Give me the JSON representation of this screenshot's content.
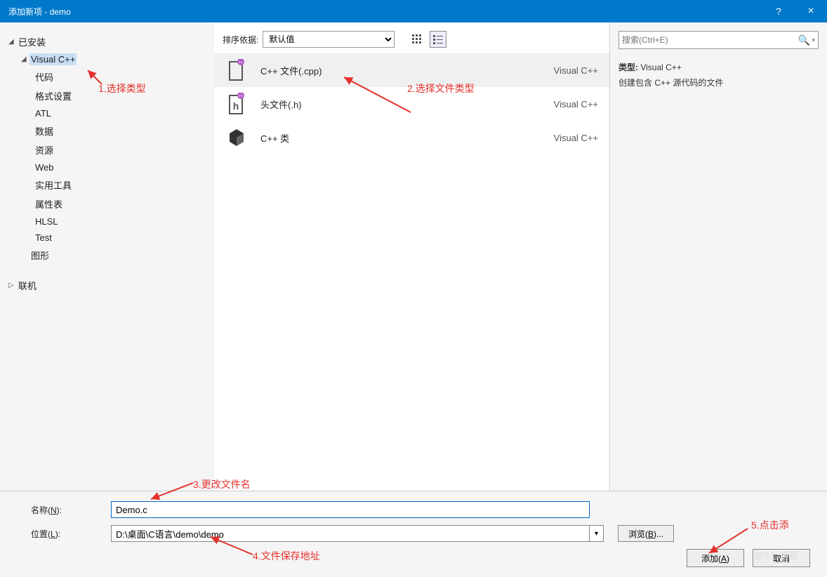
{
  "titlebar": {
    "title": "添加新项 - demo",
    "help": "?",
    "close": "×"
  },
  "sidebar": {
    "installed": "已安装",
    "visual_cpp": "Visual C++",
    "children": [
      "代码",
      "格式设置",
      "ATL",
      "数据",
      "资源",
      "Web",
      "实用工具",
      "属性表",
      "HLSL",
      "Test"
    ],
    "graphics": "图形",
    "online": "联机"
  },
  "sort": {
    "label": "排序依据:",
    "value": "默认值"
  },
  "templates": [
    {
      "name": "C++ 文件(.cpp)",
      "lang": "Visual C++"
    },
    {
      "name": "头文件(.h)",
      "lang": "Visual C++"
    },
    {
      "name": "C++ 类",
      "lang": "Visual C++"
    }
  ],
  "search": {
    "placeholder": "搜索(Ctrl+E)"
  },
  "info": {
    "type_label": "类型:",
    "type_value": "Visual C++",
    "desc": "创建包含 C++ 源代码的文件"
  },
  "form": {
    "name_label_pre": "名称(",
    "name_label_u": "N",
    "name_label_post": "):",
    "name_value": "Demo.c",
    "loc_label_pre": "位置(",
    "loc_label_u": "L",
    "loc_label_post": "):",
    "loc_value": "D:\\桌面\\C语言\\demo\\demo",
    "browse_pre": "浏览(",
    "browse_u": "B",
    "browse_post": ")...",
    "add_pre": "添加(",
    "add_u": "A",
    "add_post": ")",
    "cancel": "取消"
  },
  "annotations": {
    "a1": "1.选择类型",
    "a2": "2.选择文件类型",
    "a3": "3.更改文件名",
    "a4": "4.文件保存地址",
    "a5": "5.点击添"
  },
  "watermark": "@51      博客"
}
